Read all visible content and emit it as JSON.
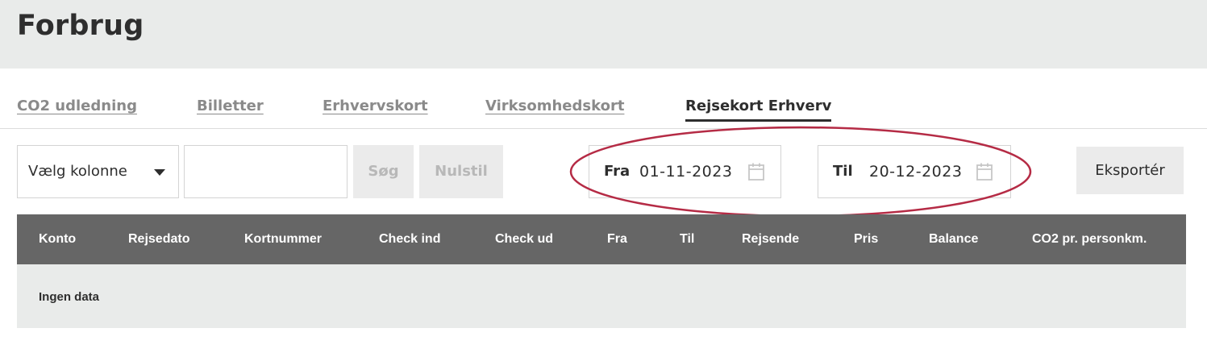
{
  "header": {
    "title": "Forbrug"
  },
  "tabs": [
    {
      "label": "CO2 udledning"
    },
    {
      "label": "Billetter"
    },
    {
      "label": "Erhvervskort"
    },
    {
      "label": "Virksomhedskort"
    },
    {
      "label": "Rejsekort Erhverv"
    }
  ],
  "active_tab": "Rejsekort Erhverv",
  "filters": {
    "column_select": "Vælg kolonne",
    "search_value": "",
    "search_label": "Søg",
    "reset_label": "Nulstil",
    "from_label": "Fra",
    "from_date": "01-11-2023",
    "to_label": "Til",
    "to_date": "20-12-2023",
    "export_label": "Eksportér"
  },
  "table": {
    "columns": [
      "Konto",
      "Rejsedato",
      "Kortnummer",
      "Check ind",
      "Check ud",
      "Fra",
      "Til",
      "Rejsende",
      "Pris",
      "Balance",
      "CO2 pr. personkm."
    ],
    "empty_text": "Ingen data"
  },
  "colors": {
    "highlight_oval": "#b52b45",
    "table_header": "#666666",
    "header_bg": "#e9ebea"
  },
  "icons": {
    "date_picker": "calendar-icon",
    "dropdown": "caret-down-icon"
  }
}
